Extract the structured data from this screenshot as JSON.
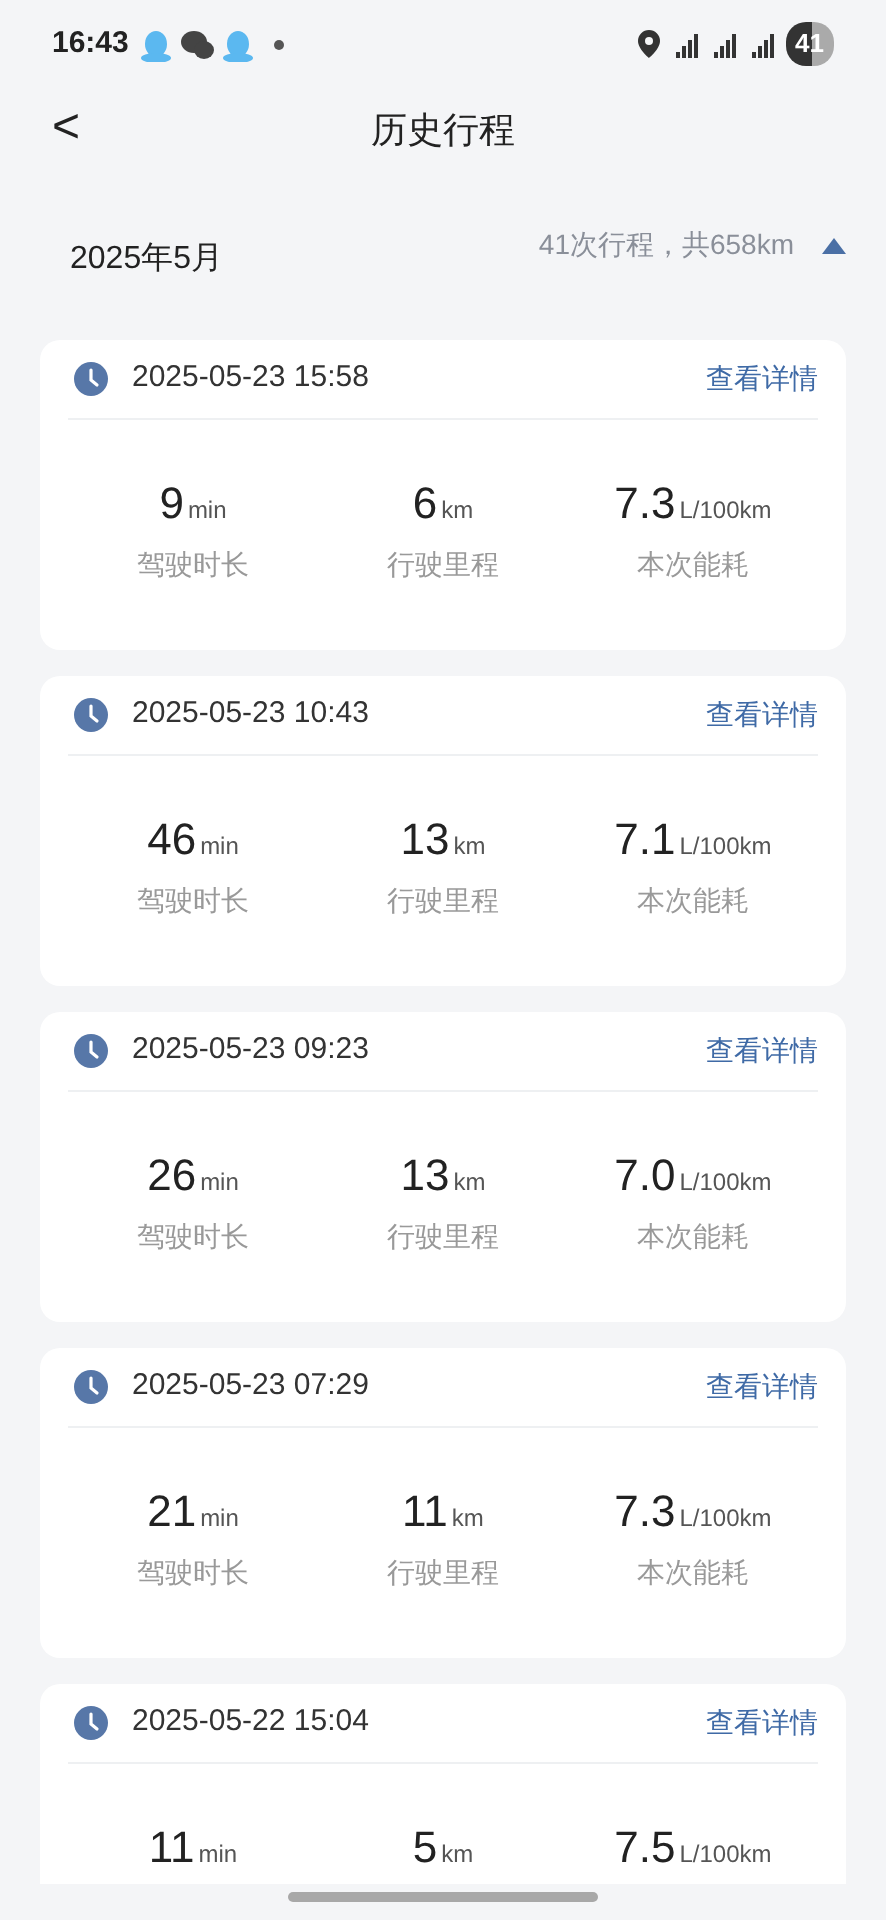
{
  "status_bar": {
    "time": "16:43",
    "battery": "41"
  },
  "header": {
    "back": "<",
    "title": "历史行程"
  },
  "month": {
    "label": "2025年5月",
    "summary": "41次行程，共658km",
    "expanded": true
  },
  "trips": [
    {
      "datetime": "2025-05-23 15:58",
      "action": "查看详情",
      "stats": [
        {
          "value": "9",
          "unit": "min",
          "label": "驾驶时长"
        },
        {
          "value": "6",
          "unit": "km",
          "label": "行驶里程"
        },
        {
          "value": "7.3",
          "unit": "L/100km",
          "label": "本次能耗"
        }
      ]
    },
    {
      "datetime": "2025-05-23 10:43",
      "action": "查看详情",
      "stats": [
        {
          "value": "46",
          "unit": "min",
          "label": "驾驶时长"
        },
        {
          "value": "13",
          "unit": "km",
          "label": "行驶里程"
        },
        {
          "value": "7.1",
          "unit": "L/100km",
          "label": "本次能耗"
        }
      ]
    },
    {
      "datetime": "2025-05-23 09:23",
      "action": "查看详情",
      "stats": [
        {
          "value": "26",
          "unit": "min",
          "label": "驾驶时长"
        },
        {
          "value": "13",
          "unit": "km",
          "label": "行驶里程"
        },
        {
          "value": "7.0",
          "unit": "L/100km",
          "label": "本次能耗"
        }
      ]
    },
    {
      "datetime": "2025-05-23 07:29",
      "action": "查看详情",
      "stats": [
        {
          "value": "21",
          "unit": "min",
          "label": "驾驶时长"
        },
        {
          "value": "11",
          "unit": "km",
          "label": "行驶里程"
        },
        {
          "value": "7.3",
          "unit": "L/100km",
          "label": "本次能耗"
        }
      ]
    },
    {
      "datetime": "2025-05-22 15:04",
      "action": "查看详情",
      "stats": [
        {
          "value": "11",
          "unit": "min"
        },
        {
          "value": "5",
          "unit": "km"
        },
        {
          "value": "7.5",
          "unit": "L/100km"
        }
      ]
    }
  ]
}
